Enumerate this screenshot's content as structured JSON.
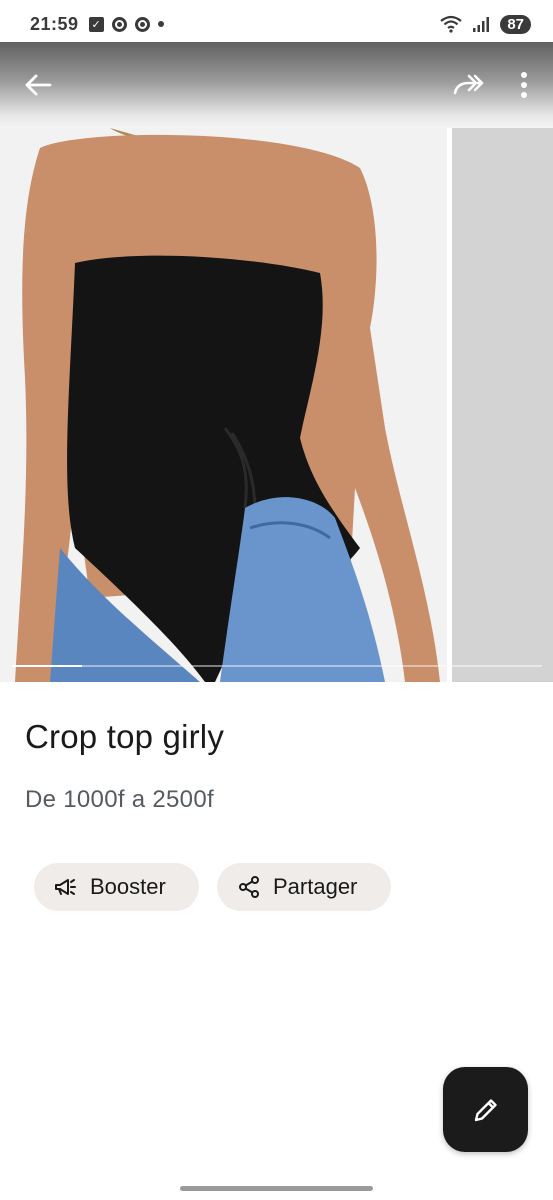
{
  "status_bar": {
    "time": "21:59",
    "battery": "87",
    "icons": [
      "check-square-icon",
      "chrome-icon",
      "chrome-icon",
      "dot-icon",
      "wifi-icon",
      "signal-icon"
    ]
  },
  "app_bar": {
    "icons": [
      "back-arrow-icon",
      "share-forward-icon",
      "more-vertical-icon"
    ]
  },
  "listing": {
    "title": "Crop top girly",
    "price": "De 1000f a 2500f",
    "image_count_indicator": {
      "current": 1,
      "total": 2
    }
  },
  "actions": {
    "booster_label": "Booster",
    "share_label": "Partager"
  },
  "fab": {
    "icon": "edit-pencil-icon"
  },
  "colors": {
    "chip_background": "#efecea",
    "fab_background": "#1b1b1b",
    "price_text": "#555b60"
  }
}
